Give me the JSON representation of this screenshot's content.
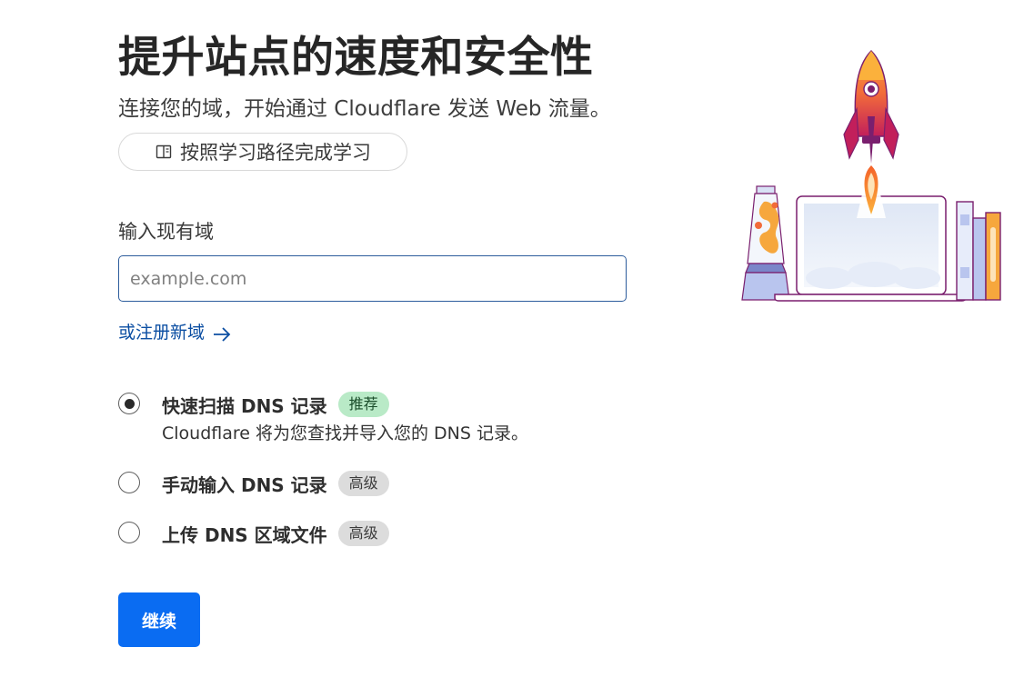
{
  "header": {
    "title": "提升站点的速度和安全性",
    "subtitle": "连接您的域，开始通过 Cloudflare 发送 Web 流量。",
    "learn_button_label": "按照学习路径完成学习"
  },
  "domain_form": {
    "label": "输入现有域",
    "input_value": "",
    "input_placeholder": "example.com",
    "register_link_label": "或注册新域"
  },
  "dns_options": [
    {
      "title": "快速扫描 DNS 记录",
      "badge": "推荐",
      "badge_color": "#b9eac7",
      "description": "Cloudflare 将为您查找并导入您的 DNS 记录。",
      "selected": true
    },
    {
      "title": "手动输入 DNS 记录",
      "badge": "高级",
      "badge_color": "#dcdcdc",
      "selected": false
    },
    {
      "title": "上传 DNS 区域文件",
      "badge": "高级",
      "badge_color": "#dcdcdc",
      "selected": false
    }
  ],
  "actions": {
    "continue_label": "继续"
  },
  "colors": {
    "primary": "#0a6cf2",
    "link": "#0b4ea2",
    "input_border": "#2c5c9c"
  },
  "icons": {
    "learn": "book-icon",
    "register": "arrow-right-icon",
    "illustration": "rocket-laptop-illustration"
  }
}
